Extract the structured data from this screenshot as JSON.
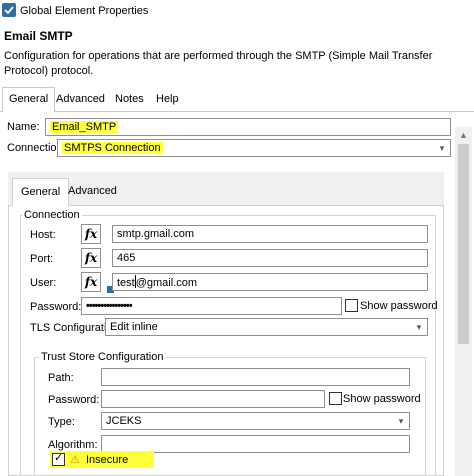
{
  "window": {
    "title": "Global Element Properties"
  },
  "header": {
    "title": "Email SMTP",
    "description": "Configuration for operations that are performed through the SMTP (Simple Mail Transfer Protocol) protocol."
  },
  "tabs": [
    "General",
    "Advanced",
    "Notes",
    "Help"
  ],
  "general": {
    "name_label": "Name:",
    "name_value": "Email_SMTP",
    "connection_label": "Connection",
    "connection_value": "SMTPS Connection"
  },
  "inner_tabs": [
    "General",
    "Advanced"
  ],
  "connection_group": {
    "legend": "Connection",
    "host_label": "Host:",
    "host_value": "smtp.gmail.com",
    "port_label": "Port:",
    "port_value": "465",
    "user_label": "User:",
    "user_value_before_cursor": "test",
    "user_value_after_cursor": "@gmail.com",
    "password_label": "Password:",
    "password_value": "••••••••••••••••",
    "show_password_label": "Show password",
    "tls_label": "TLS Configuration",
    "tls_value": "Edit inline"
  },
  "trust_store": {
    "legend": "Trust Store Configuration",
    "path_label": "Path:",
    "path_value": "",
    "password_label": "Password:",
    "password_value": "",
    "show_password_label": "Show password",
    "type_label": "Type:",
    "type_value": "JCEKS",
    "algorithm_label": "Algorithm:",
    "algorithm_value": "",
    "insecure_label": "Insecure",
    "insecure_checked": true
  },
  "icons": {
    "fx": "fx",
    "combo": "▾",
    "scroll_up": "▲",
    "warning": "⚠"
  },
  "colors": {
    "highlight": "#ffff3a",
    "app_icon": "#2d6ea3"
  }
}
